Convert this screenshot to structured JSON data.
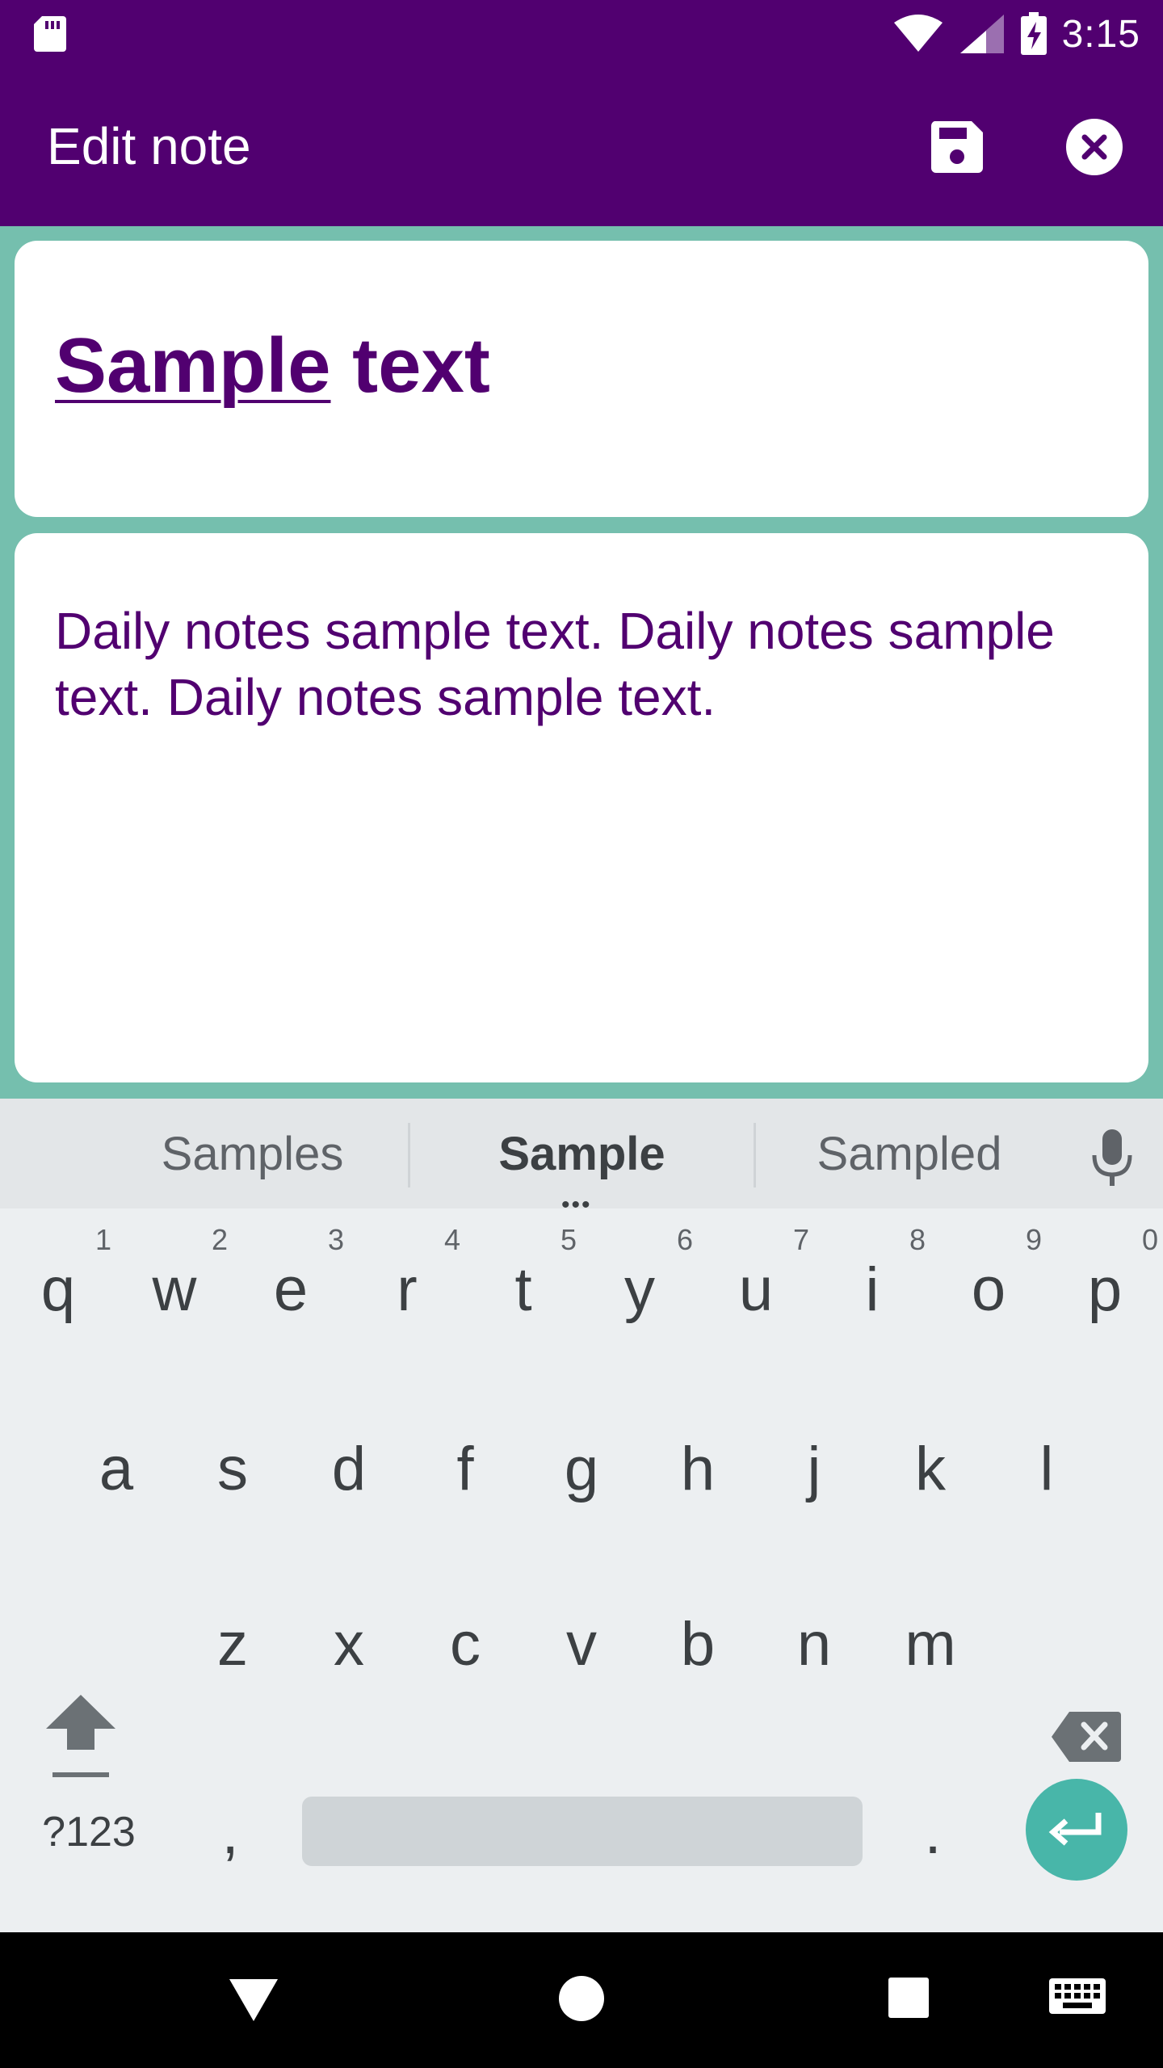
{
  "status_bar": {
    "time": "3:15"
  },
  "app_bar": {
    "title": "Edit note",
    "save_icon": "save-icon",
    "close_icon": "close-icon"
  },
  "note": {
    "title_underlined": "Sample",
    "title_rest": " text",
    "body": "Daily notes sample text. Daily notes sample text. Daily notes sample text."
  },
  "keyboard": {
    "suggestions": [
      "Samples",
      "Sample",
      "Sampled"
    ],
    "row1": [
      {
        "k": "q",
        "h": "1"
      },
      {
        "k": "w",
        "h": "2"
      },
      {
        "k": "e",
        "h": "3"
      },
      {
        "k": "r",
        "h": "4"
      },
      {
        "k": "t",
        "h": "5"
      },
      {
        "k": "y",
        "h": "6"
      },
      {
        "k": "u",
        "h": "7"
      },
      {
        "k": "i",
        "h": "8"
      },
      {
        "k": "o",
        "h": "9"
      },
      {
        "k": "p",
        "h": "0"
      }
    ],
    "row2": [
      "a",
      "s",
      "d",
      "f",
      "g",
      "h",
      "j",
      "k",
      "l"
    ],
    "row3": [
      "z",
      "x",
      "c",
      "v",
      "b",
      "n",
      "m"
    ],
    "symbols_label": "?123",
    "comma": ",",
    "period": "."
  },
  "colors": {
    "primary": "#510070",
    "accent": "#75bfae",
    "enter": "#48b6a9"
  }
}
